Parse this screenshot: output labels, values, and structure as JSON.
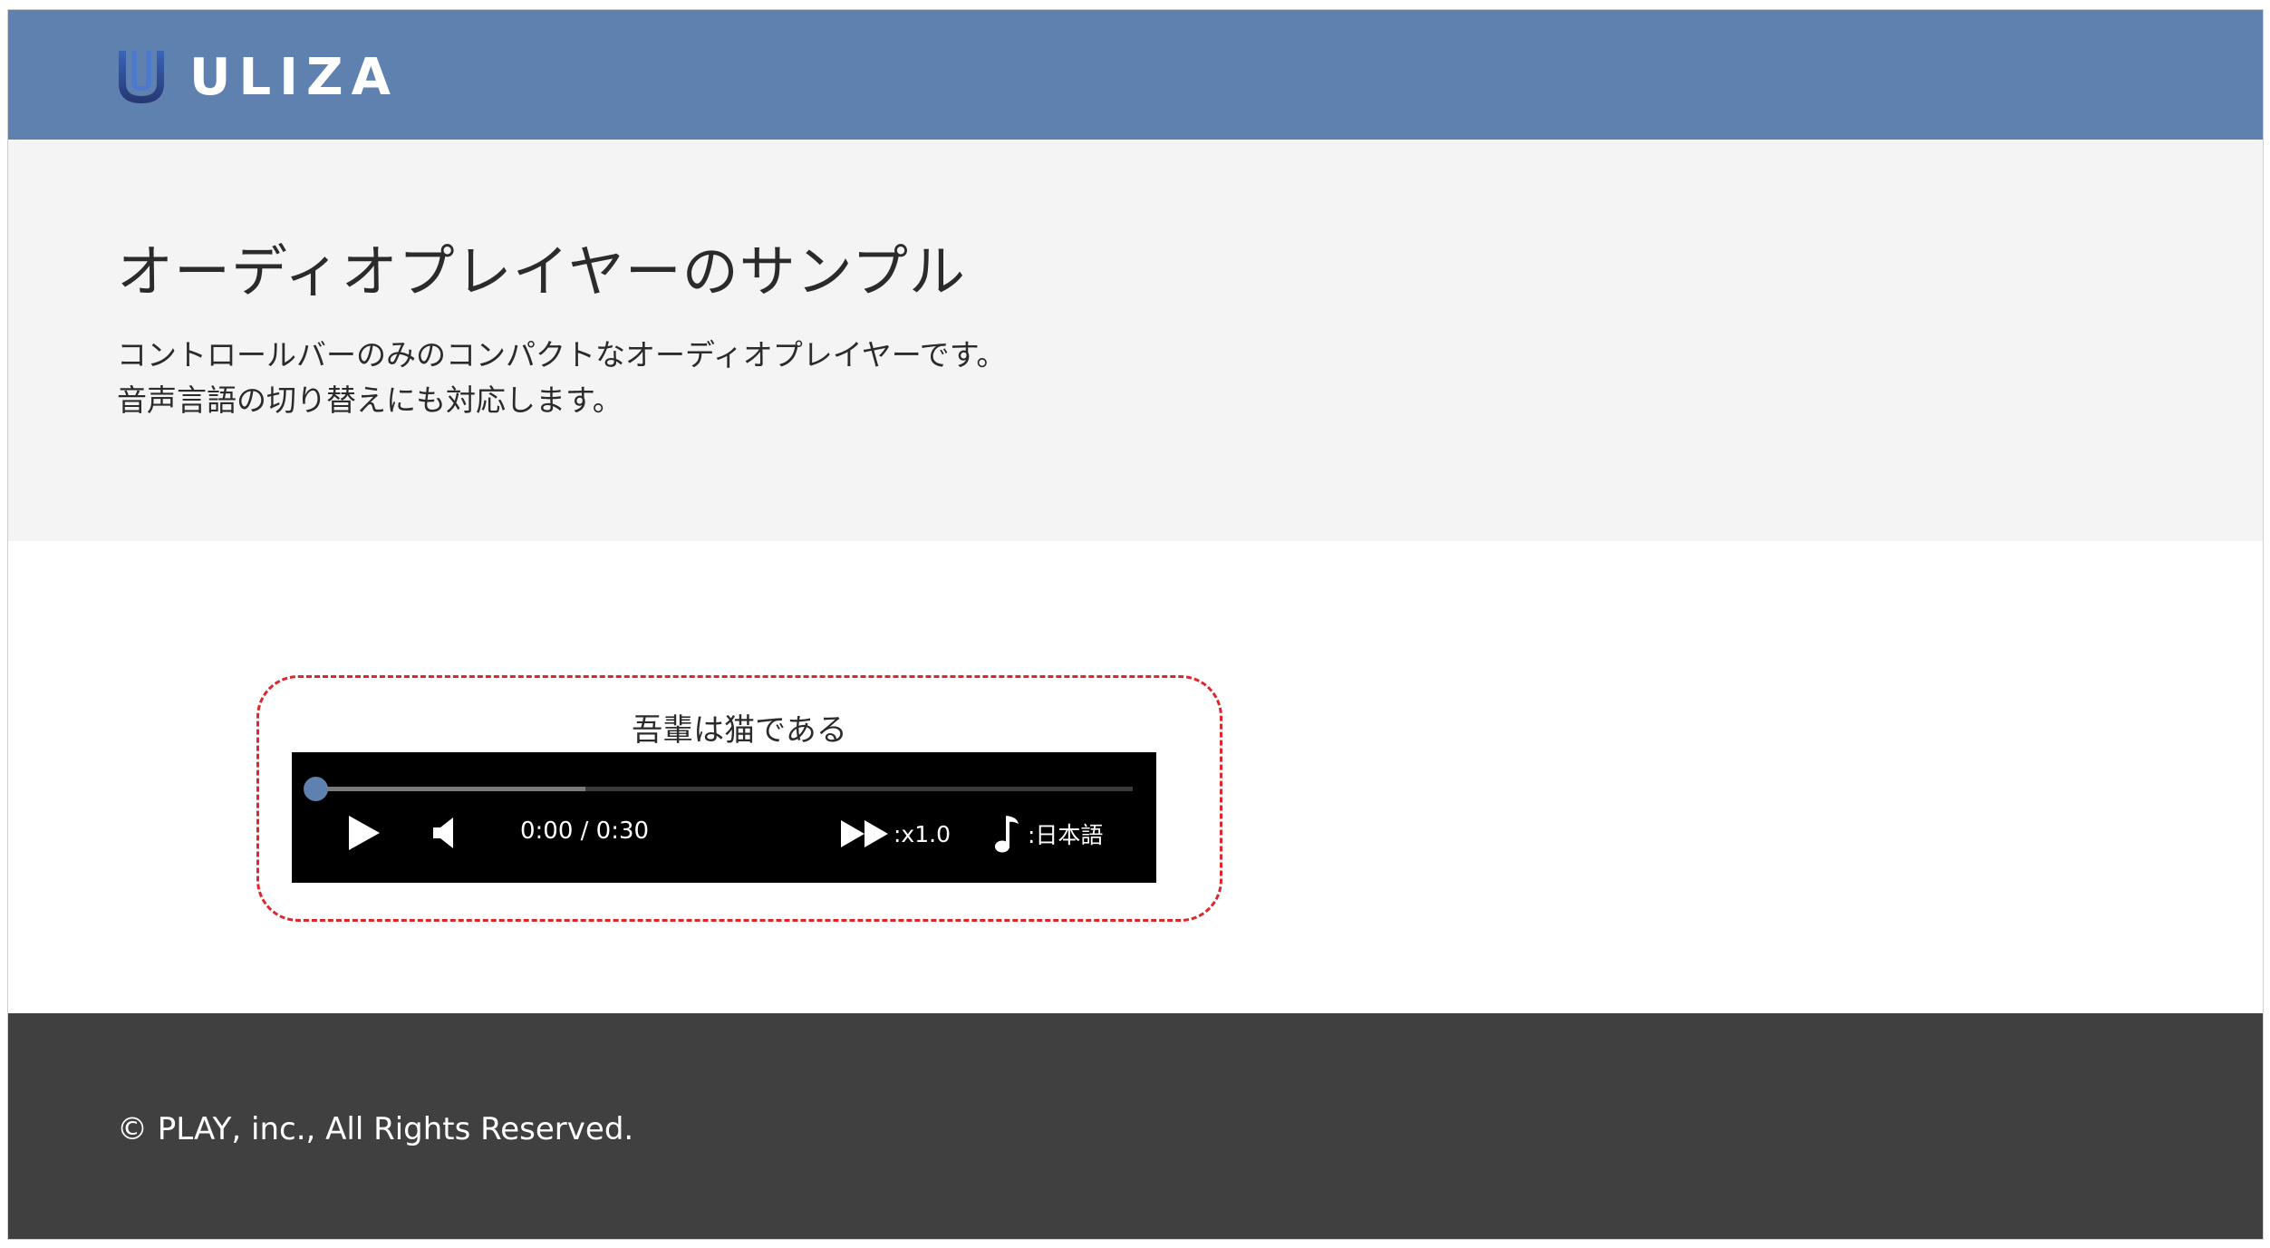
{
  "header": {
    "logo_text": "ULIZA",
    "brand_color": "#5e81b0"
  },
  "hero": {
    "title": "オーディオプレイヤーのサンプル",
    "description_line1": "コントロールバーのみのコンパクトなオーディオプレイヤーです。",
    "description_line2": "音声言語の切り替えにも対応します。"
  },
  "player": {
    "track_title": "吾輩は猫である",
    "time_display": "0:00 / 0:30",
    "current_time": "0:00",
    "duration": "0:30",
    "progress_fraction": 0.0,
    "buffered_fraction": 0.33,
    "playback_rate_label": ":x1.0",
    "audio_language_label": ":日本語",
    "play_icon": "play-icon",
    "volume_icon": "volume-icon",
    "rate_icon": "fast-forward-icon",
    "language_icon": "music-note-icon",
    "highlight_border_color": "#e0262d"
  },
  "footer": {
    "copyright": "© PLAY, inc., All Rights Reserved."
  }
}
